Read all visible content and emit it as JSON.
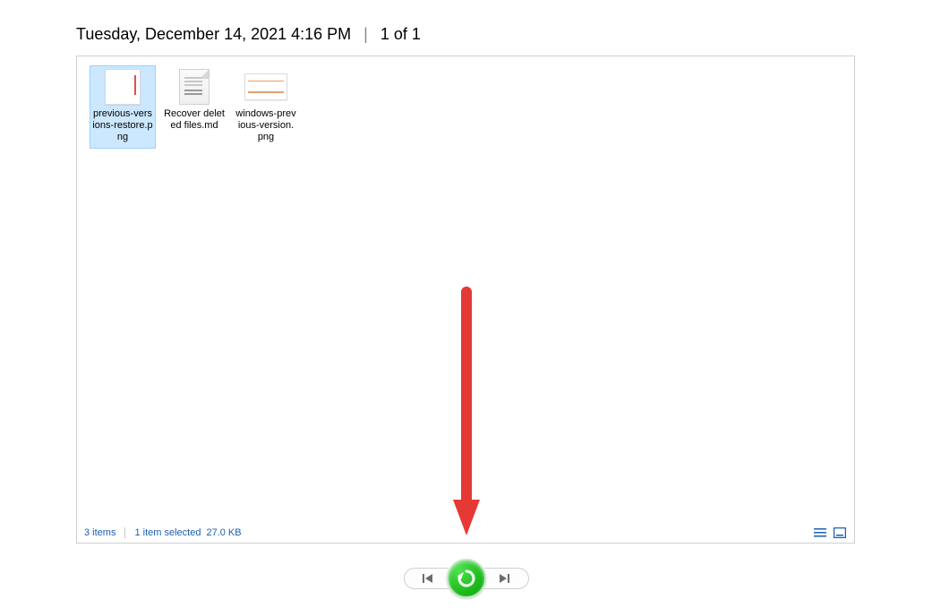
{
  "header": {
    "timestamp": "Tuesday, December 14, 2021 4:16 PM",
    "position": "1 of 1"
  },
  "files": [
    {
      "name": "previous-versions-restore.png",
      "label": "previous-versions-restore.png",
      "selected": true,
      "icon": "image-thumb-1"
    },
    {
      "name": "Recover deleted files.md",
      "label": "Recover deleted files.md",
      "selected": false,
      "icon": "markdown-file"
    },
    {
      "name": "windows-previous-version.png",
      "label": "windows-previous-version.png",
      "selected": false,
      "icon": "image-thumb-2"
    }
  ],
  "status": {
    "item_count": "3 items",
    "selection": "1 item selected",
    "size": "27.0 KB"
  },
  "nav": {
    "prev_label": "Previous version",
    "restore_label": "Restore",
    "next_label": "Next version"
  },
  "colors": {
    "selection_bg": "#cce8ff",
    "selection_border": "#99d1ff",
    "status_text": "#1a5fb4",
    "restore_green": "#1fbf1f",
    "arrow_red": "#e53935"
  }
}
